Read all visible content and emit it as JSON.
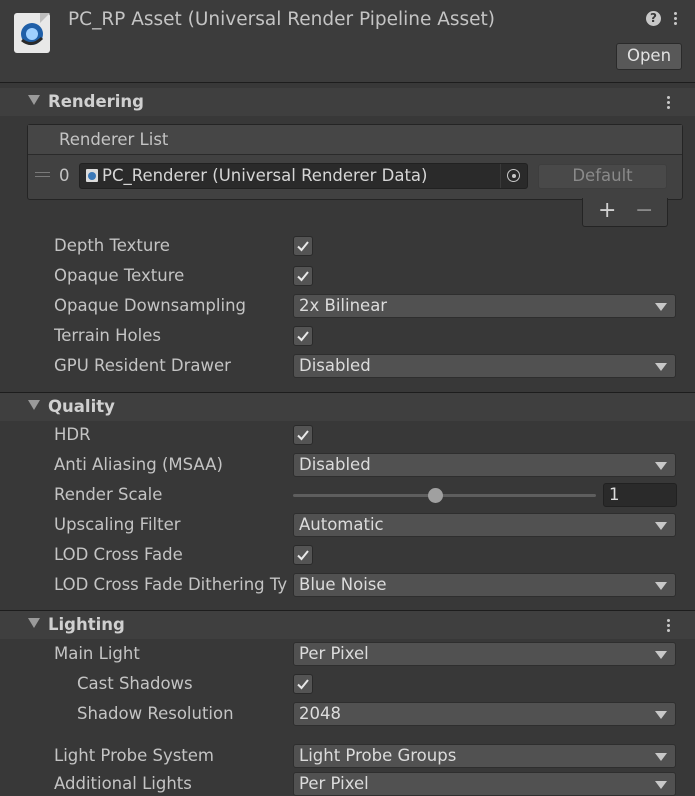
{
  "header": {
    "title": "PC_RP Asset (Universal Render Pipeline Asset)",
    "open_label": "Open",
    "icons": {
      "asset": "urp-asset-icon",
      "help": "help-icon",
      "menu": "kebab-menu-icon"
    }
  },
  "rendering": {
    "title": "Rendering",
    "renderer_list": {
      "title": "Renderer List",
      "rows": [
        {
          "index": "0",
          "value": "PC_Renderer (Universal Renderer Data)",
          "default_label": "Default"
        }
      ],
      "add_label": "+",
      "remove_label": "−"
    },
    "depth_texture": {
      "label": "Depth Texture",
      "checked": true
    },
    "opaque_texture": {
      "label": "Opaque Texture",
      "checked": true
    },
    "opaque_downsampling": {
      "label": "Opaque Downsampling",
      "value": "2x Bilinear"
    },
    "terrain_holes": {
      "label": "Terrain Holes",
      "checked": true
    },
    "gpu_resident_drawer": {
      "label": "GPU Resident Drawer",
      "value": "Disabled"
    }
  },
  "quality": {
    "title": "Quality",
    "hdr": {
      "label": "HDR",
      "checked": true
    },
    "msaa": {
      "label": "Anti Aliasing (MSAA)",
      "value": "Disabled"
    },
    "render_scale": {
      "label": "Render Scale",
      "value": "1",
      "min": 0.1,
      "max": 2
    },
    "upscaling_filter": {
      "label": "Upscaling Filter",
      "value": "Automatic"
    },
    "lod_cross_fade": {
      "label": "LOD Cross Fade",
      "checked": true
    },
    "lod_dither": {
      "label": "LOD Cross Fade Dithering Type",
      "value": "Blue Noise"
    }
  },
  "lighting": {
    "title": "Lighting",
    "main_light": {
      "label": "Main Light",
      "value": "Per Pixel"
    },
    "cast_shadows": {
      "label": "Cast Shadows",
      "checked": true
    },
    "shadow_resolution": {
      "label": "Shadow Resolution",
      "value": "2048"
    },
    "light_probe_system": {
      "label": "Light Probe System",
      "value": "Light Probe Groups"
    },
    "additional_lights": {
      "label": "Additional Lights",
      "value": "Per Pixel"
    }
  },
  "colors": {
    "background": "#383838",
    "field": "#515151",
    "text": "#c4c4c4"
  }
}
